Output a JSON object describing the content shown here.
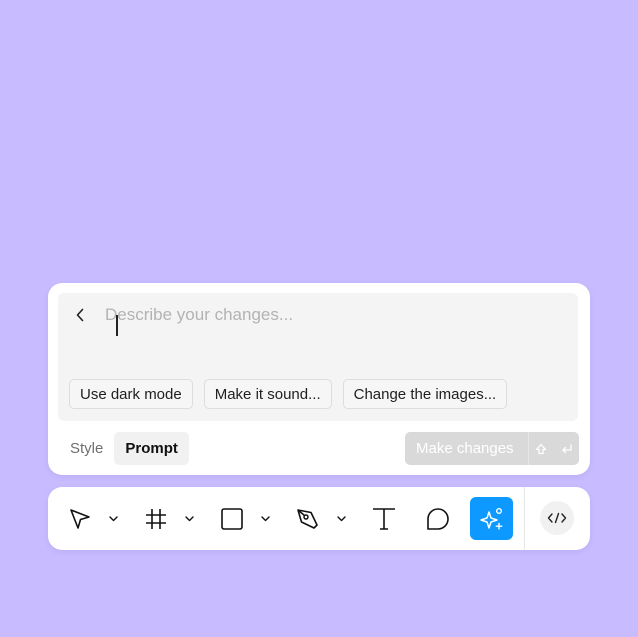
{
  "prompt": {
    "placeholder": "Describe your changes...",
    "value": "",
    "suggestions": [
      {
        "label": "Use dark mode"
      },
      {
        "label": "Make it sound..."
      },
      {
        "label": "Change the images..."
      }
    ]
  },
  "modes": {
    "style_label": "Style",
    "prompt_label": "Prompt",
    "active": "Prompt"
  },
  "submit": {
    "label": "Make changes",
    "disabled": true,
    "shortcut_icons": [
      "shift-icon",
      "enter-icon"
    ]
  },
  "toolbar": {
    "tools": [
      {
        "name": "move-tool",
        "icon": "pointer-arrow-icon",
        "has_menu": true
      },
      {
        "name": "frame-tool",
        "icon": "frame-hash-icon",
        "has_menu": true
      },
      {
        "name": "rectangle-tool",
        "icon": "rectangle-icon",
        "has_menu": true
      },
      {
        "name": "pen-tool",
        "icon": "pen-nib-icon",
        "has_menu": true
      },
      {
        "name": "text-tool",
        "icon": "text-t-icon",
        "has_menu": false
      },
      {
        "name": "comment-tool",
        "icon": "speech-bubble-icon",
        "has_menu": false
      },
      {
        "name": "ai-tool",
        "icon": "sparkle-icon",
        "has_menu": false,
        "active": true
      }
    ],
    "dev_mode_icon": "code-brackets-icon",
    "accent_color": "#0d99ff"
  },
  "colors": {
    "background": "#c8bbff",
    "panel": "#ffffff",
    "input_bg": "#f4f4f4"
  }
}
